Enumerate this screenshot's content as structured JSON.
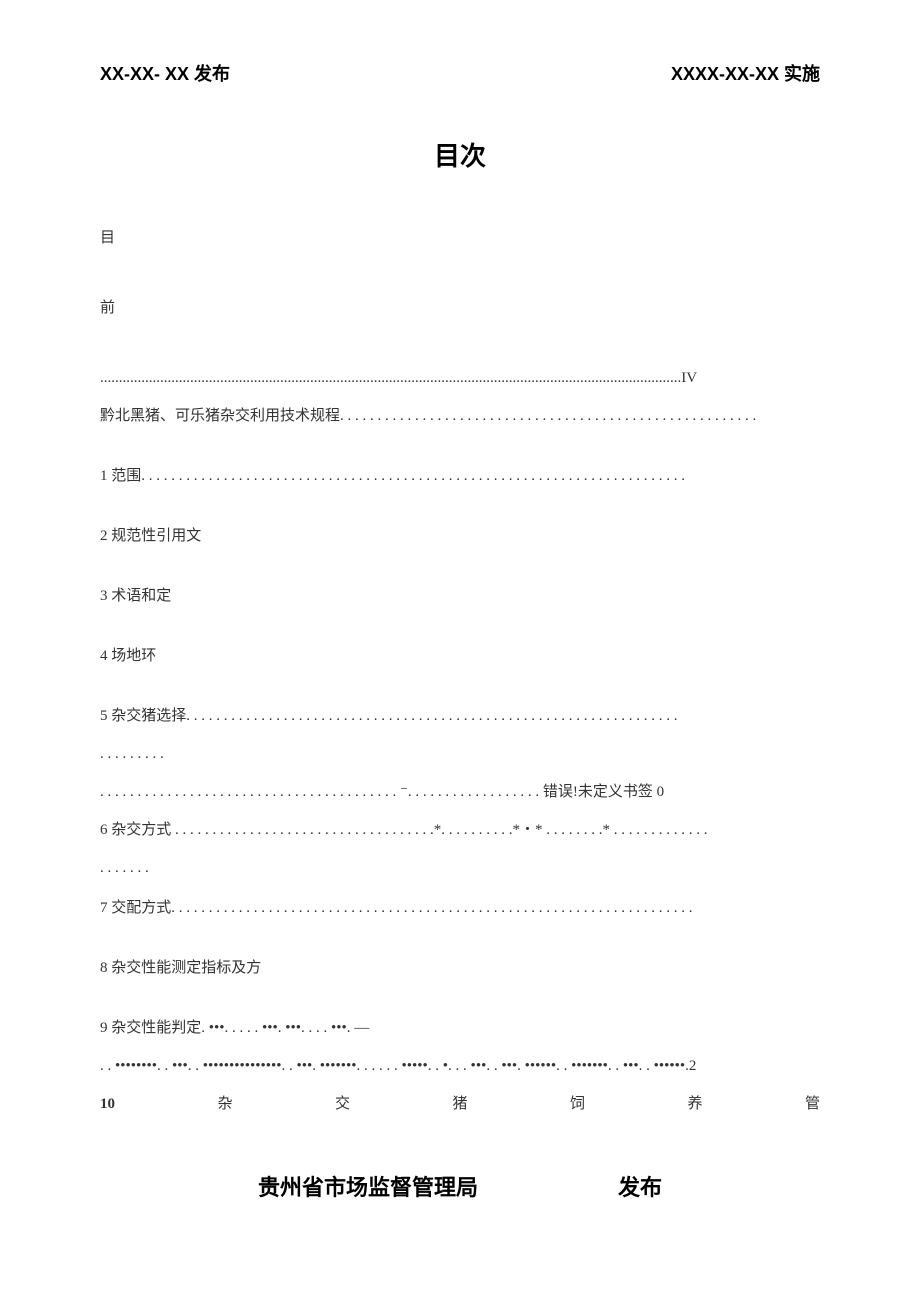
{
  "header": {
    "left": "XX-XX- XX 发布",
    "right": "XXXX-XX-XX 实施"
  },
  "title": "目次",
  "toc": {
    "mu": "目",
    "qian": "前",
    "line_iv": "...........................................................................................................................................................IV",
    "main_rule": "黔北黑猪、可乐猪杂交利用技术规程. . . . . . . . . . . . . . . . . . . . . . . . . . . . . . . . . . . . . . . . . . . . . . . . . . . . . . . .",
    "item1": "1 范围. . . . . . . . .  . . . . . . . . . .  . . . . . . .  . . .  . . . . . . .  . . . . . .  . . . . . . . .  . . . . . . . . . . . . . .  . . . . . . .  . .",
    "item2": "2 规范性引用文",
    "item3": "3 术语和定",
    "item4": "4 场地环",
    "item5a": "5 杂交猪选择. . . .  . . . . . . . . .  . . . . . . .  .  . . . . .  . . .  . . .  . . . . . . . . . . . . . . . . . . .  . .  . . . . . . . . . . . . .",
    "item5b": ". . . . . . . .  .",
    "item5c": ". .  . . . . . . . . . . . . . . . . . . . . . . . . . . . . . . . . . . . . . . ⁻. . . . . . .  . . .  .  . . . . . . . 错误!未定义书签 0",
    "item6a": "6 杂交方式 . . . . . . . . . . . . . . . . . . . . . . . . . . . . . . . .   . . .*. . . . . . . . . .*・*  . . . . . . . .*  . . .  . . . . . . . . . .",
    "item6b": ". . . . . . .",
    "item7": "7 交配方式. . . . .  . . . . . . . . .  . . . . . . .  . . . . . . . . . . . .  . . . . .  . . . . . . . .  . . . . . . . . . . . . . . . . . . . . .  . .  .",
    "item8": "8 杂交性能测定指标及方",
    "item9a": "9 杂交性能判定. •••. . . . .  •••.  •••. . . .  •••. —",
    "item9b": ". .  ••••••••. .  •••. .  •••••••••••••••. .  •••.  •••••••. . . . . .  •••••. .  •. . .  •••. .  •••.  ••••••. .  •••••••. .  •••. .  ••••••.2",
    "item10": {
      "n": "10",
      "c1": "杂",
      "c2": "交",
      "c3": "猪",
      "c4": "饲",
      "c5": "养",
      "c6": "管"
    }
  },
  "footer": {
    "left": "贵州省市场监督管理局",
    "right": "发布"
  }
}
